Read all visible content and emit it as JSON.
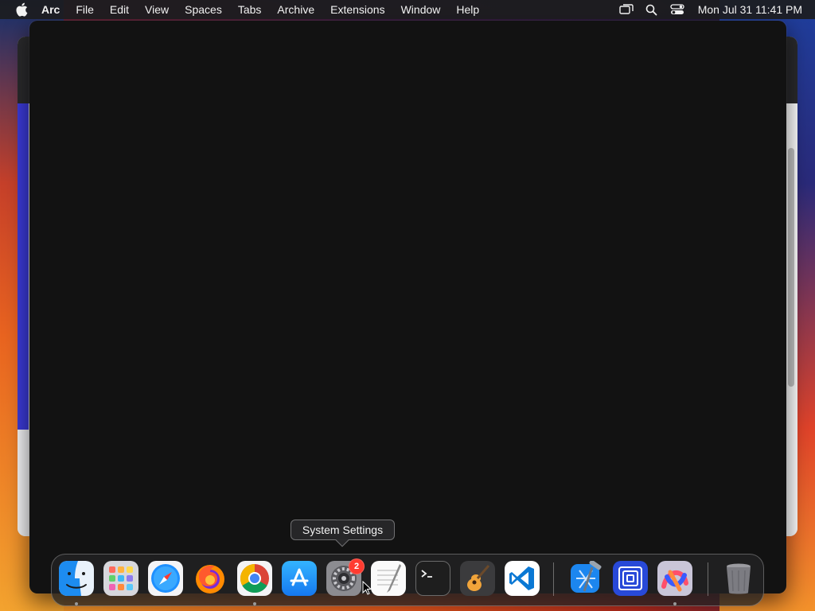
{
  "menubar": {
    "app_name": "Arc",
    "items": [
      "File",
      "Edit",
      "View",
      "Spaces",
      "Tabs",
      "Archive",
      "Extensions",
      "Window",
      "Help"
    ],
    "clock": "Mon Jul 31  11:41 PM",
    "status_icons": [
      "screen-mirroring-icon",
      "search-icon",
      "control-center-icon"
    ]
  },
  "tooltip": {
    "text": "System Settings"
  },
  "dock": {
    "apps": [
      {
        "name": "Finder",
        "icon": "finder-icon",
        "running": true
      },
      {
        "name": "Launchpad",
        "icon": "launchpad-icon",
        "running": false
      },
      {
        "name": "Safari",
        "icon": "safari-icon",
        "running": false
      },
      {
        "name": "Firefox",
        "icon": "firefox-icon",
        "running": false
      },
      {
        "name": "Google Chrome",
        "icon": "chrome-icon",
        "running": true
      },
      {
        "name": "App Store",
        "icon": "app-store-icon",
        "running": false
      },
      {
        "name": "System Settings",
        "icon": "system-settings-icon",
        "running": false,
        "badge": "2"
      },
      {
        "name": "TextEdit",
        "icon": "textedit-icon",
        "running": false
      },
      {
        "name": "Terminal",
        "icon": "terminal-icon",
        "running": false
      },
      {
        "name": "GarageBand",
        "icon": "garageband-icon",
        "running": false
      },
      {
        "name": "Visual Studio Code",
        "icon": "vscode-icon",
        "running": false
      },
      {
        "name": "Xcode",
        "icon": "xcode-icon",
        "running": false
      },
      {
        "name": "Simulator",
        "icon": "simulator-icon",
        "running": false
      },
      {
        "name": "Arc",
        "icon": "arc-icon",
        "running": true
      },
      {
        "name": "Trash",
        "icon": "trash-icon",
        "running": false
      }
    ]
  },
  "colors": {
    "menubar_bg": "#1c1c1e",
    "window_bg": "#121212",
    "badge": "#ff3b30"
  }
}
